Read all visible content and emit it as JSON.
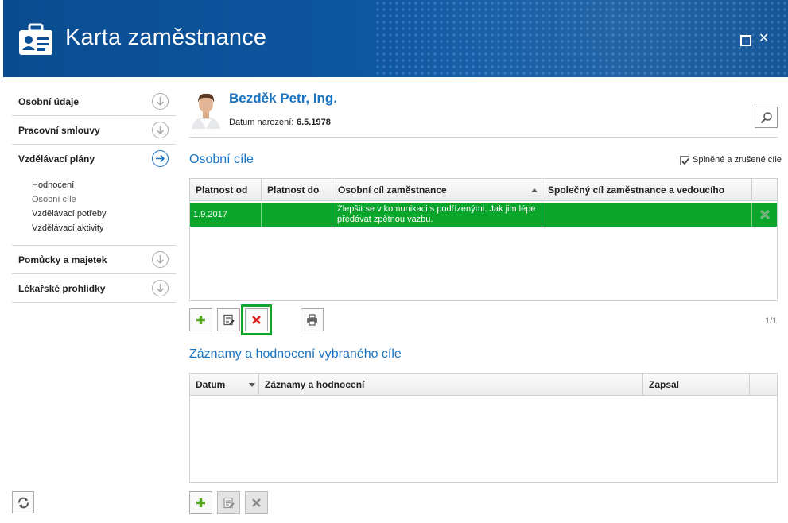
{
  "window": {
    "title": "Karta zaměstnance",
    "maximize_icon": "maximize-icon",
    "close_label": "✕"
  },
  "sidebar": {
    "items": [
      {
        "label": "Osobní údaje",
        "icon": "arrow-down-circle-icon"
      },
      {
        "label": "Pracovní smlouvy",
        "icon": "arrow-down-circle-icon"
      },
      {
        "label": "Vzdělávací plány",
        "icon": "arrow-right-circle-icon",
        "active": true
      },
      {
        "label": "Pomůcky a majetek",
        "icon": "arrow-down-circle-icon"
      },
      {
        "label": "Lékařské prohlídky",
        "icon": "arrow-down-circle-icon"
      }
    ],
    "subitems": [
      "Hodnocení",
      "Osobní cíle",
      "Vzdělávací potřeby",
      "Vzdělávací aktivity"
    ],
    "selected_subitem": "Osobní cíle"
  },
  "employee": {
    "name": "Bezděk Petr, Ing.",
    "dob_label": "Datum narození:",
    "dob_value": "6.5.1978"
  },
  "goals": {
    "title": "Osobní cíle",
    "show_completed_label": "Splněné a zrušené cíle",
    "show_completed_checked": true,
    "columns": [
      "Platnost od",
      "Platnost do",
      "Osobní cíl zaměstnance",
      "Společný cíl zaměstnance a vedoucího"
    ],
    "rows": [
      {
        "valid_from": "1.9.2017",
        "valid_to": "",
        "goal": "Zlepšit se v komunikaci s podřízenými. Jak jim lépe předávat zpětnou vazbu.",
        "shared_goal": ""
      }
    ],
    "pager": "1/1"
  },
  "records": {
    "title": "Záznamy a hodnocení vybraného cíle",
    "columns": [
      "Datum",
      "Záznamy a hodnocení",
      "Zapsal"
    ],
    "rows": []
  },
  "colors": {
    "header_blue": "#0a4f95",
    "accent_blue": "#1a73c0",
    "selected_row_green": "#0aa52b",
    "delete_red": "#e11d1d",
    "add_green": "#55a81e"
  }
}
